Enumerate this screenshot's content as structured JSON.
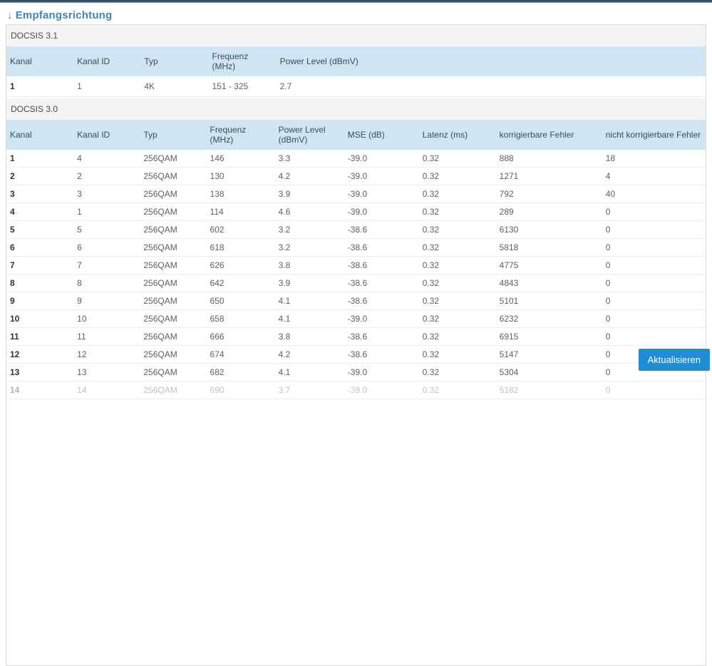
{
  "header": {
    "arrow": "↓",
    "title": "Empfangsrichtung"
  },
  "colors": {
    "accent_blue": "#4285b8",
    "table_header_bg": "#cfe5f4",
    "section_band_bg": "#f4f4f4",
    "button_bg": "#1e8fd5",
    "top_bar": "#2e4d68"
  },
  "sections": [
    {
      "title": "DOCSIS 3.1",
      "table": {
        "headers": [
          "Kanal",
          "Kanal ID",
          "Typ",
          "Frequenz (MHz)",
          "Power Level (dBmV)"
        ],
        "rows": [
          [
            "1",
            "1",
            "4K",
            "151 - 325",
            "2.7"
          ]
        ]
      }
    },
    {
      "title": "DOCSIS 3.0",
      "table": {
        "headers": [
          "Kanal",
          "Kanal ID",
          "Typ",
          "Frequenz (MHz)",
          "Power Level (dBmV)",
          "MSE (dB)",
          "Latenz (ms)",
          "korrigierbare Fehler",
          "nicht korrigierbare Fehler"
        ],
        "rows": [
          [
            "1",
            "4",
            "256QAM",
            "146",
            "3.3",
            "-39.0",
            "0.32",
            "888",
            "18"
          ],
          [
            "2",
            "2",
            "256QAM",
            "130",
            "4.2",
            "-39.0",
            "0.32",
            "1271",
            "4"
          ],
          [
            "3",
            "3",
            "256QAM",
            "138",
            "3.9",
            "-39.0",
            "0.32",
            "792",
            "40"
          ],
          [
            "4",
            "1",
            "256QAM",
            "114",
            "4.6",
            "-39.0",
            "0.32",
            "289",
            "0"
          ],
          [
            "5",
            "5",
            "256QAM",
            "602",
            "3.2",
            "-38.6",
            "0.32",
            "6130",
            "0"
          ],
          [
            "6",
            "6",
            "256QAM",
            "618",
            "3.2",
            "-38.6",
            "0.32",
            "5818",
            "0"
          ],
          [
            "7",
            "7",
            "256QAM",
            "626",
            "3.8",
            "-38.6",
            "0.32",
            "4775",
            "0"
          ],
          [
            "8",
            "8",
            "256QAM",
            "642",
            "3.9",
            "-38.6",
            "0.32",
            "4843",
            "0"
          ],
          [
            "9",
            "9",
            "256QAM",
            "650",
            "4.1",
            "-38.6",
            "0.32",
            "5101",
            "0"
          ],
          [
            "10",
            "10",
            "256QAM",
            "658",
            "4.1",
            "-39.0",
            "0.32",
            "6232",
            "0"
          ],
          [
            "11",
            "11",
            "256QAM",
            "666",
            "3.8",
            "-38.6",
            "0.32",
            "6915",
            "0"
          ],
          [
            "12",
            "12",
            "256QAM",
            "674",
            "4.2",
            "-38.6",
            "0.32",
            "5147",
            "0"
          ],
          [
            "13",
            "13",
            "256QAM",
            "682",
            "4.1",
            "-39.0",
            "0.32",
            "5304",
            "0"
          ],
          [
            "14",
            "14",
            "256QAM",
            "690",
            "3.7",
            "-39.0",
            "0.32",
            "5182",
            "0"
          ]
        ]
      }
    }
  ],
  "footer": {
    "refresh_button_label": "Aktualisieren"
  }
}
